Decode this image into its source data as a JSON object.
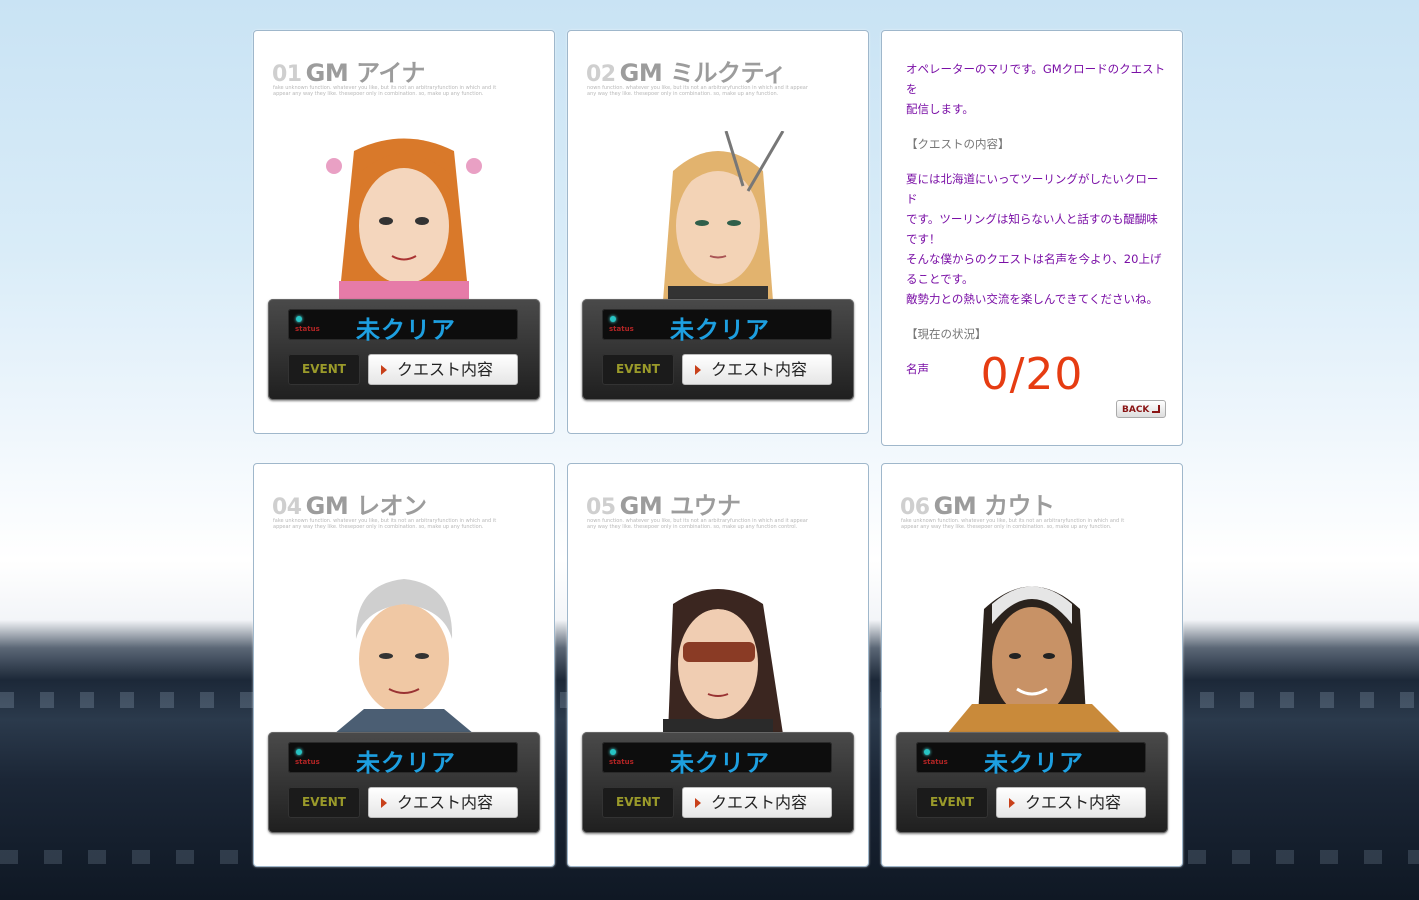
{
  "cards": [
    {
      "num": "01",
      "name": "GM アイナ",
      "desc": "fake unknown function. whatever you like, but its not an arbitraryfunction in which and it appear any way they like. thesepoer only in combination. so, make up any function.",
      "status_label": "status",
      "status": "未クリア",
      "event": "EVENT",
      "quest_btn": "クエスト内容",
      "hair": "#d9792a"
    },
    {
      "num": "02",
      "name": "GM ミルクティ",
      "desc": "nown function. whatever you like, but its not an arbitraryfunction in which and it appear any way they like. thesepoer only in combination. so, make up any function.",
      "status_label": "status",
      "status": "未クリア",
      "event": "EVENT",
      "quest_btn": "クエスト内容",
      "hair": "#e2b36e"
    },
    {
      "num": "04",
      "name": "GM レオン",
      "desc": "fake unknown function. whatever you like, but its not an arbitraryfunction in which and it appear any way they like. thesepoer only in combination. so, make up any function.",
      "status_label": "status",
      "status": "未クリア",
      "event": "EVENT",
      "quest_btn": "クエスト内容",
      "hair": "#cfcfcf"
    },
    {
      "num": "05",
      "name": "GM ユウナ",
      "desc": "nown function. whatever you like, but its not an arbitraryfunction in which and it appear any way they like. thesepoer only in combination. so, make up any function control.",
      "status_label": "status",
      "status": "未クリア",
      "event": "EVENT",
      "quest_btn": "クエスト内容",
      "hair": "#3b2620"
    },
    {
      "num": "06",
      "name": "GM カウト",
      "desc": "fake unknown function. whatever you like, but its not an arbitraryfunction in which and it appear any way they like. thesepoer only in combination. so, make up any function.",
      "status_label": "status",
      "status": "未クリア",
      "event": "EVENT",
      "quest_btn": "クエスト内容",
      "hair": "#2a221c"
    }
  ],
  "info": {
    "intro1": "オペレーターのマリです。GMクロードのクエストを",
    "intro2": "配信します。",
    "section_content": "【クエストの内容】",
    "body1": "夏には北海道にいってツーリングがしたいクロード",
    "body2": "です。ツーリングは知らない人と話すのも醍醐味",
    "body3": "です！",
    "body4": "そんな僕からのクエストは名声を今より、20上げ",
    "body5": "ることです。",
    "body6": "敵勢力との熱い交流を楽しんできてくださいね。",
    "section_status": "【現在の状況】",
    "fame_label": "名声",
    "counter": "0/20",
    "back": "BACK"
  },
  "colors": {
    "status_text": "#1d9fe0",
    "counter": "#e63c12",
    "info_text": "#7a0fa6"
  }
}
